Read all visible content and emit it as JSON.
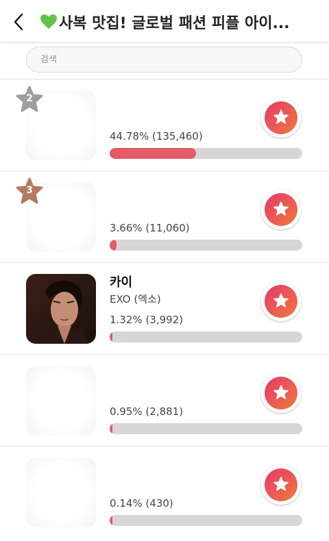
{
  "header": {
    "back_icon": "chevron-left-icon",
    "heart_icon": "green-heart-icon",
    "title": "사복 맛집! 글로벌 패션 피플 아이..."
  },
  "search": {
    "placeholder": "검색",
    "value": ""
  },
  "colors": {
    "bar_fill": "#e35a68",
    "bar_track": "#d6d6d6",
    "vote_gradient_start": "#e5386d",
    "vote_gradient_end": "#f07a3c",
    "rank_2_badge": "#9e9e9e",
    "rank_3_badge": "#b57a5c"
  },
  "rows": [
    {
      "rank": "2",
      "name": "",
      "group": "",
      "stat": "44.78% (135,460)",
      "percent": 44.78,
      "vote_icon": "star-icon"
    },
    {
      "rank": "3",
      "name": "",
      "group": "",
      "stat": "3.66% (11,060)",
      "percent": 3.66,
      "vote_icon": "star-icon"
    },
    {
      "rank": "",
      "name": "카이",
      "group": "EXO (엑소)",
      "stat": "1.32% (3,992)",
      "percent": 1.32,
      "vote_icon": "star-icon"
    },
    {
      "rank": "",
      "name": "",
      "group": "",
      "stat": "0.95% (2,881)",
      "percent": 0.95,
      "vote_icon": "star-icon"
    },
    {
      "rank": "",
      "name": "",
      "group": "",
      "stat": "0.14% (430)",
      "percent": 0.14,
      "vote_icon": "star-icon"
    }
  ]
}
